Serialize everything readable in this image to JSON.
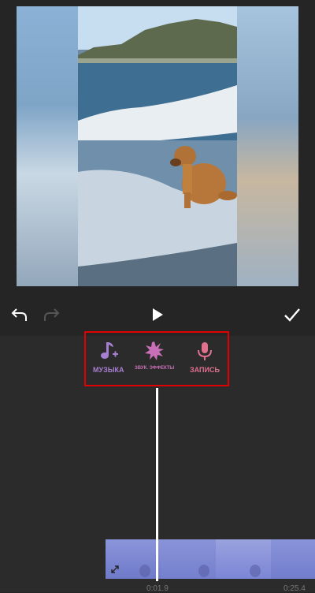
{
  "effects": {
    "music_label": "МУЗЫКА",
    "sfx_label": "ЗВУК. ЭФФЕКТЫ",
    "record_label": "ЗАПИСЬ"
  },
  "timeline": {
    "current_time": "0:01.9",
    "end_time": "0:25.4"
  },
  "icons": {
    "undo": "undo-icon",
    "redo": "redo-icon",
    "play": "play-icon",
    "done": "checkmark-icon",
    "music": "music-note-add-icon",
    "sfx": "burst-icon",
    "record": "microphone-icon"
  },
  "colors": {
    "music_accent": "#a77fd1",
    "sfx_accent": "#c86fb7",
    "record_accent": "#e0708e",
    "highlight_border": "#e00000",
    "clip_tint": "#7b86d6"
  }
}
